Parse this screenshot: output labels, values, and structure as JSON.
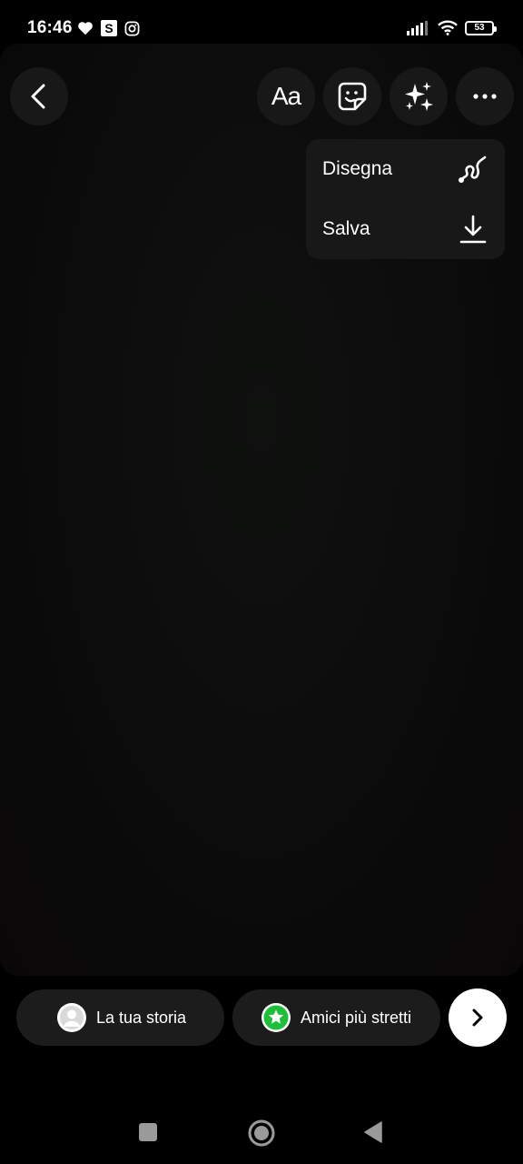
{
  "status_bar": {
    "time": "16:46",
    "s_badge": "S",
    "battery_level": "53"
  },
  "toolbar": {
    "text_tool_label": "Aa"
  },
  "menu": {
    "items": [
      {
        "label": "Disegna",
        "icon": "draw-squiggle-icon"
      },
      {
        "label": "Salva",
        "icon": "download-icon"
      }
    ]
  },
  "share": {
    "your_story_label": "La tua storia",
    "close_friends_label": "Amici più stretti",
    "close_friends_color": "#1fbf3b"
  }
}
